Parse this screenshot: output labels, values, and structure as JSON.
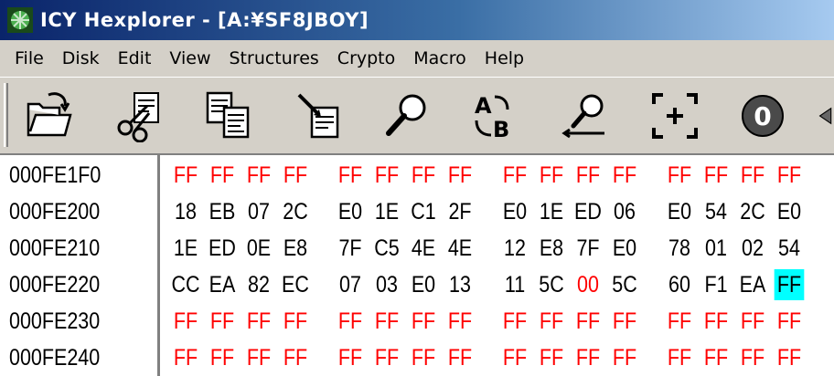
{
  "window": {
    "title": "ICY Hexplorer - [A:¥SF8JBOY]"
  },
  "menu": {
    "items": [
      "File",
      "Disk",
      "Edit",
      "View",
      "Structures",
      "Crypto",
      "Macro",
      "Help"
    ]
  },
  "toolbar": {
    "buttons": [
      "open-icon",
      "cut-icon",
      "copy-icon",
      "paste-icon",
      "find-icon",
      "replace-icon",
      "find-replace-icon",
      "goto-icon",
      "zero-icon",
      "nav-icon"
    ]
  },
  "hex": {
    "rows": [
      {
        "address": "000FE1F0",
        "bytes": [
          "FF",
          "FF",
          "FF",
          "FF",
          "FF",
          "FF",
          "FF",
          "FF",
          "FF",
          "FF",
          "FF",
          "FF",
          "FF",
          "FF",
          "FF",
          "FF"
        ]
      },
      {
        "address": "000FE200",
        "bytes": [
          "18",
          "EB",
          "07",
          "2C",
          "E0",
          "1E",
          "C1",
          "2F",
          "E0",
          "1E",
          "ED",
          "06",
          "E0",
          "54",
          "2C",
          "E0"
        ]
      },
      {
        "address": "000FE210",
        "bytes": [
          "1E",
          "ED",
          "0E",
          "E8",
          "7F",
          "C5",
          "4E",
          "4E",
          "12",
          "E8",
          "7F",
          "E0",
          "78",
          "01",
          "02",
          "54"
        ]
      },
      {
        "address": "000FE220",
        "bytes": [
          "CC",
          "EA",
          "82",
          "EC",
          "07",
          "03",
          "E0",
          "13",
          "11",
          "5C",
          "00",
          "5C",
          "60",
          "F1",
          "EA",
          "FF"
        ]
      },
      {
        "address": "000FE230",
        "bytes": [
          "FF",
          "FF",
          "FF",
          "FF",
          "FF",
          "FF",
          "FF",
          "FF",
          "FF",
          "FF",
          "FF",
          "FF",
          "FF",
          "FF",
          "FF",
          "FF"
        ]
      },
      {
        "address": "000FE240",
        "bytes": [
          "FF",
          "FF",
          "FF",
          "FF",
          "FF",
          "FF",
          "FF",
          "FF",
          "FF",
          "FF",
          "FF",
          "FF",
          "FF",
          "FF",
          "FF",
          "FF"
        ]
      }
    ],
    "highlight_color": "#ff0000",
    "selection_color": "#00ffff"
  }
}
